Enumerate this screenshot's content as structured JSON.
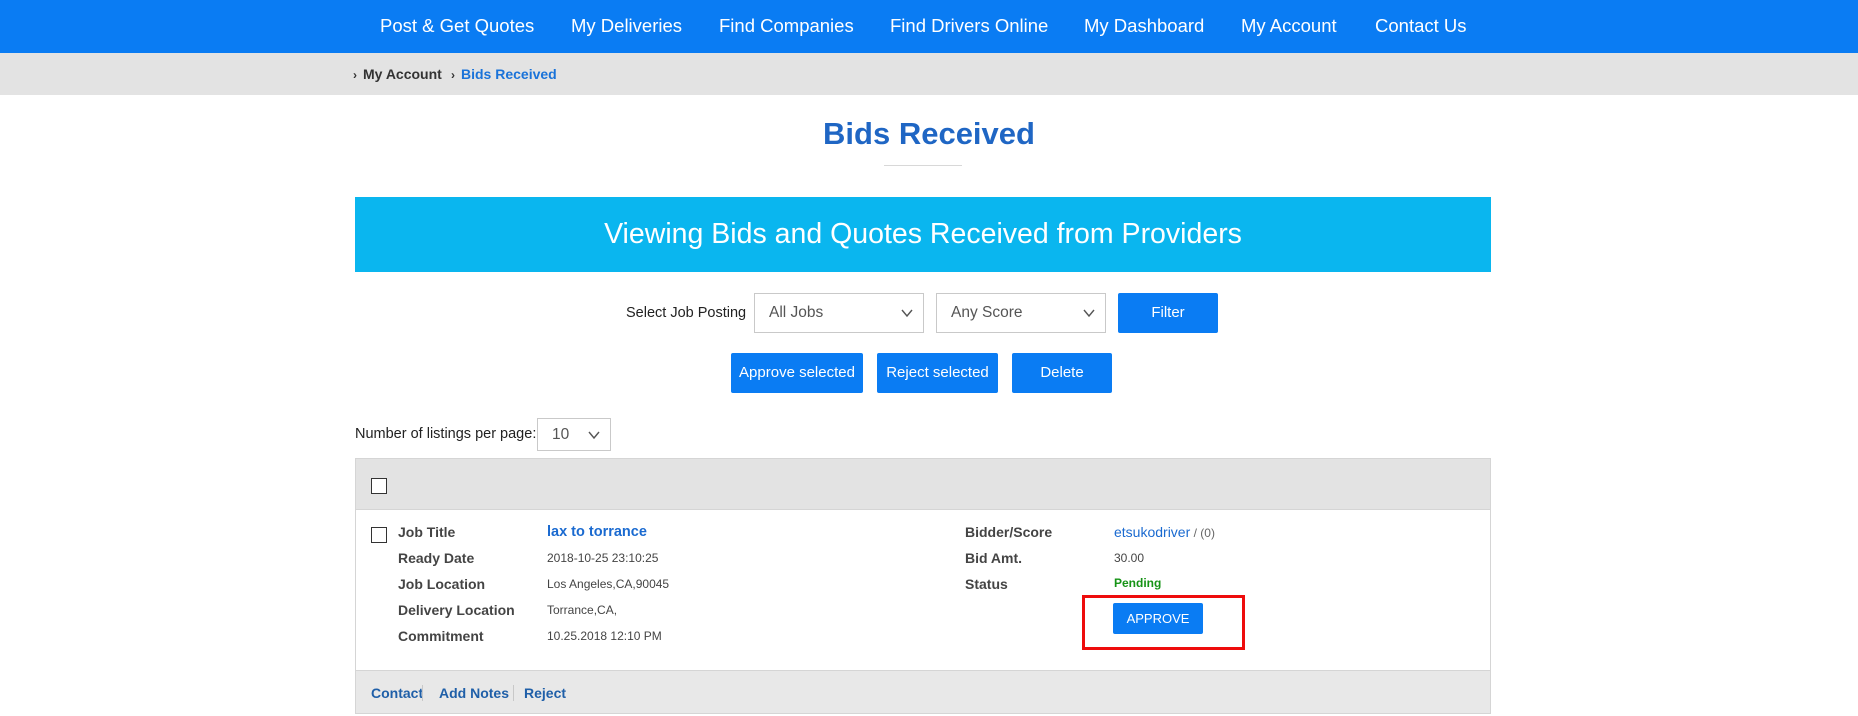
{
  "nav": {
    "items": [
      {
        "label": "Post & Get Quotes"
      },
      {
        "label": "My Deliveries"
      },
      {
        "label": "Find Companies"
      },
      {
        "label": "Find Drivers Online"
      },
      {
        "label": "My Dashboard"
      },
      {
        "label": "My Account"
      },
      {
        "label": "Contact Us"
      }
    ]
  },
  "breadcrumb": {
    "items": [
      {
        "label": "My Account"
      },
      {
        "label": "Bids Received"
      }
    ]
  },
  "page": {
    "title": "Bids Received",
    "banner": "Viewing Bids and Quotes Received from Providers"
  },
  "filters": {
    "label": "Select Job Posting",
    "job_select": "All Jobs",
    "score_select": "Any Score",
    "filter_button": "Filter"
  },
  "actions": {
    "approve_selected": "Approve selected",
    "reject_selected": "Reject selected",
    "delete": "Delete"
  },
  "pagination": {
    "label": "Number of listings per page:",
    "per_page": "10"
  },
  "listing": {
    "labels": {
      "job_title": "Job Title",
      "ready_date": "Ready Date",
      "job_location": "Job Location",
      "delivery_location": "Delivery Location",
      "commitment": "Commitment",
      "bidder_score": "Bidder/Score",
      "bid_amount": "Bid Amt.",
      "status": "Status"
    },
    "values": {
      "job_title": "lax to torrance",
      "ready_date": "2018-10-25 23:10:25",
      "job_location": "Los Angeles,CA,90045",
      "delivery_location": "Torrance,CA,",
      "commitment": "10.25.2018 12:10 PM",
      "bidder": "etsukodriver",
      "score": " / (0)",
      "bid_amount": "30.00",
      "status": "Pending"
    },
    "approve_button": "APPROVE",
    "footer_links": [
      {
        "label": "Contact"
      },
      {
        "label": "Add Notes"
      },
      {
        "label": "Reject"
      }
    ]
  },
  "colors": {
    "nav_bg": "#0a7cf3",
    "banner_bg": "#0ab6ef",
    "title": "#1f66c4",
    "status_pending": "#169316",
    "highlight": "#ee0c0c"
  }
}
